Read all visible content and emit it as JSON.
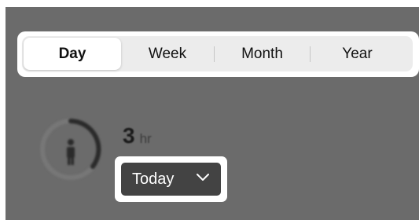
{
  "tabs": [
    {
      "label": "Day",
      "selected": true
    },
    {
      "label": "Week",
      "selected": false
    },
    {
      "label": "Month",
      "selected": false
    },
    {
      "label": "Year",
      "selected": false
    }
  ],
  "summary": {
    "value": "3",
    "unit": "hr"
  },
  "range_dropdown": {
    "selected": "Today"
  },
  "icons": {
    "ring": "person-ring-icon",
    "chevron": "chevron-down-icon"
  },
  "colors": {
    "backdrop": "#6b6b6b",
    "dropdown_bg": "#434343",
    "segment_bg": "#ececec"
  }
}
